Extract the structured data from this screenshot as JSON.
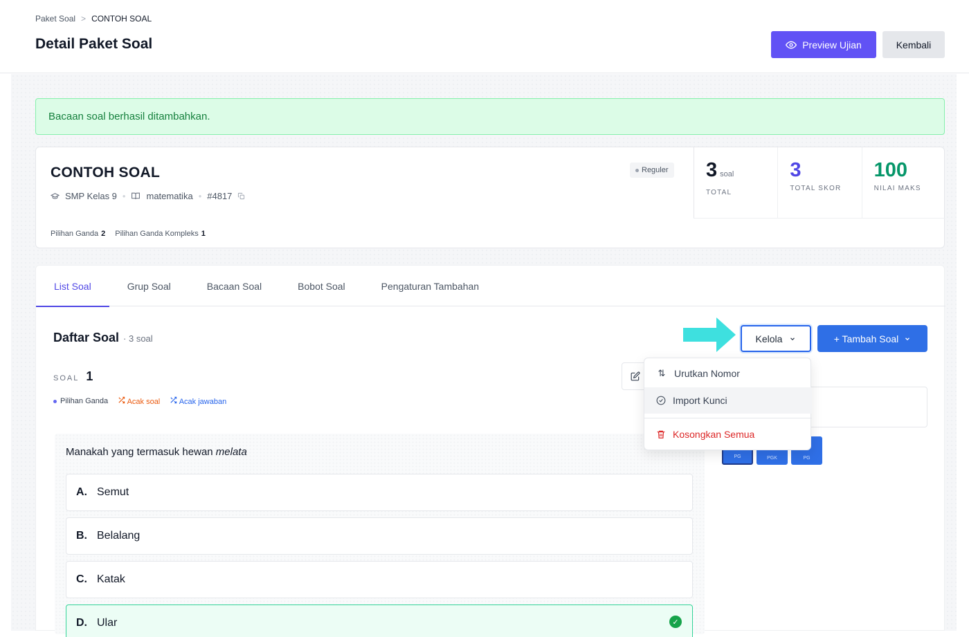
{
  "breadcrumb": {
    "root": "Paket Soal",
    "separator": ">",
    "current": "CONTOH SOAL"
  },
  "header": {
    "title": "Detail Paket Soal",
    "preview_label": "Preview Ujian",
    "back_label": "Kembali"
  },
  "alert": {
    "message": "Bacaan soal berhasil ditambahkan."
  },
  "package": {
    "title": "CONTOH SOAL",
    "grade": "SMP Kelas 9",
    "subject": "matematika",
    "id": "#4817",
    "badge": "Reguler",
    "stats": [
      {
        "value": "3",
        "unit": "soal",
        "label": "TOTAL",
        "color": "#111827"
      },
      {
        "value": "3",
        "unit": "",
        "label": "TOTAL SKOR",
        "color": "#4f46e5"
      },
      {
        "value": "100",
        "unit": "",
        "label": "NILAI MAKS",
        "color": "#059669"
      }
    ],
    "types": [
      {
        "label": "Pilihan Ganda",
        "count": "2"
      },
      {
        "label": "Pilihan Ganda Kompleks",
        "count": "1"
      }
    ]
  },
  "tabs": [
    "List Soal",
    "Grup Soal",
    "Bacaan Soal",
    "Bobot Soal",
    "Pengaturan Tambahan"
  ],
  "daftar": {
    "title": "Daftar Soal",
    "count": "· 3 soal",
    "kelola_label": "Kelola",
    "tambah_label": "+ Tambah Soal"
  },
  "dropdown": {
    "items": [
      "Urutkan Nomor",
      "Import Kunci",
      "Kosongkan Semua"
    ]
  },
  "soal": {
    "label": "SOAL",
    "number": "1",
    "tags": {
      "type": "Pilihan Ganda",
      "acak_soal": "Acak soal",
      "acak_jawaban": "Acak jawaban"
    },
    "question_prefix": "Manakah yang termasuk hewan ",
    "question_emphasis": "melata",
    "options": [
      {
        "letter": "A.",
        "text": "Semut",
        "correct": false
      },
      {
        "letter": "B.",
        "text": "Belalang",
        "correct": false
      },
      {
        "letter": "C.",
        "text": "Katak",
        "correct": false
      },
      {
        "letter": "D.",
        "text": "Ular",
        "correct": true
      }
    ]
  },
  "mini_tiles": [
    "PG",
    "PGK",
    "PG"
  ],
  "colors": {
    "primary": "#6152f5",
    "blue": "#2f6fe6",
    "success": "#16a34a",
    "danger": "#dc2626",
    "arrow": "#3ee0df"
  }
}
